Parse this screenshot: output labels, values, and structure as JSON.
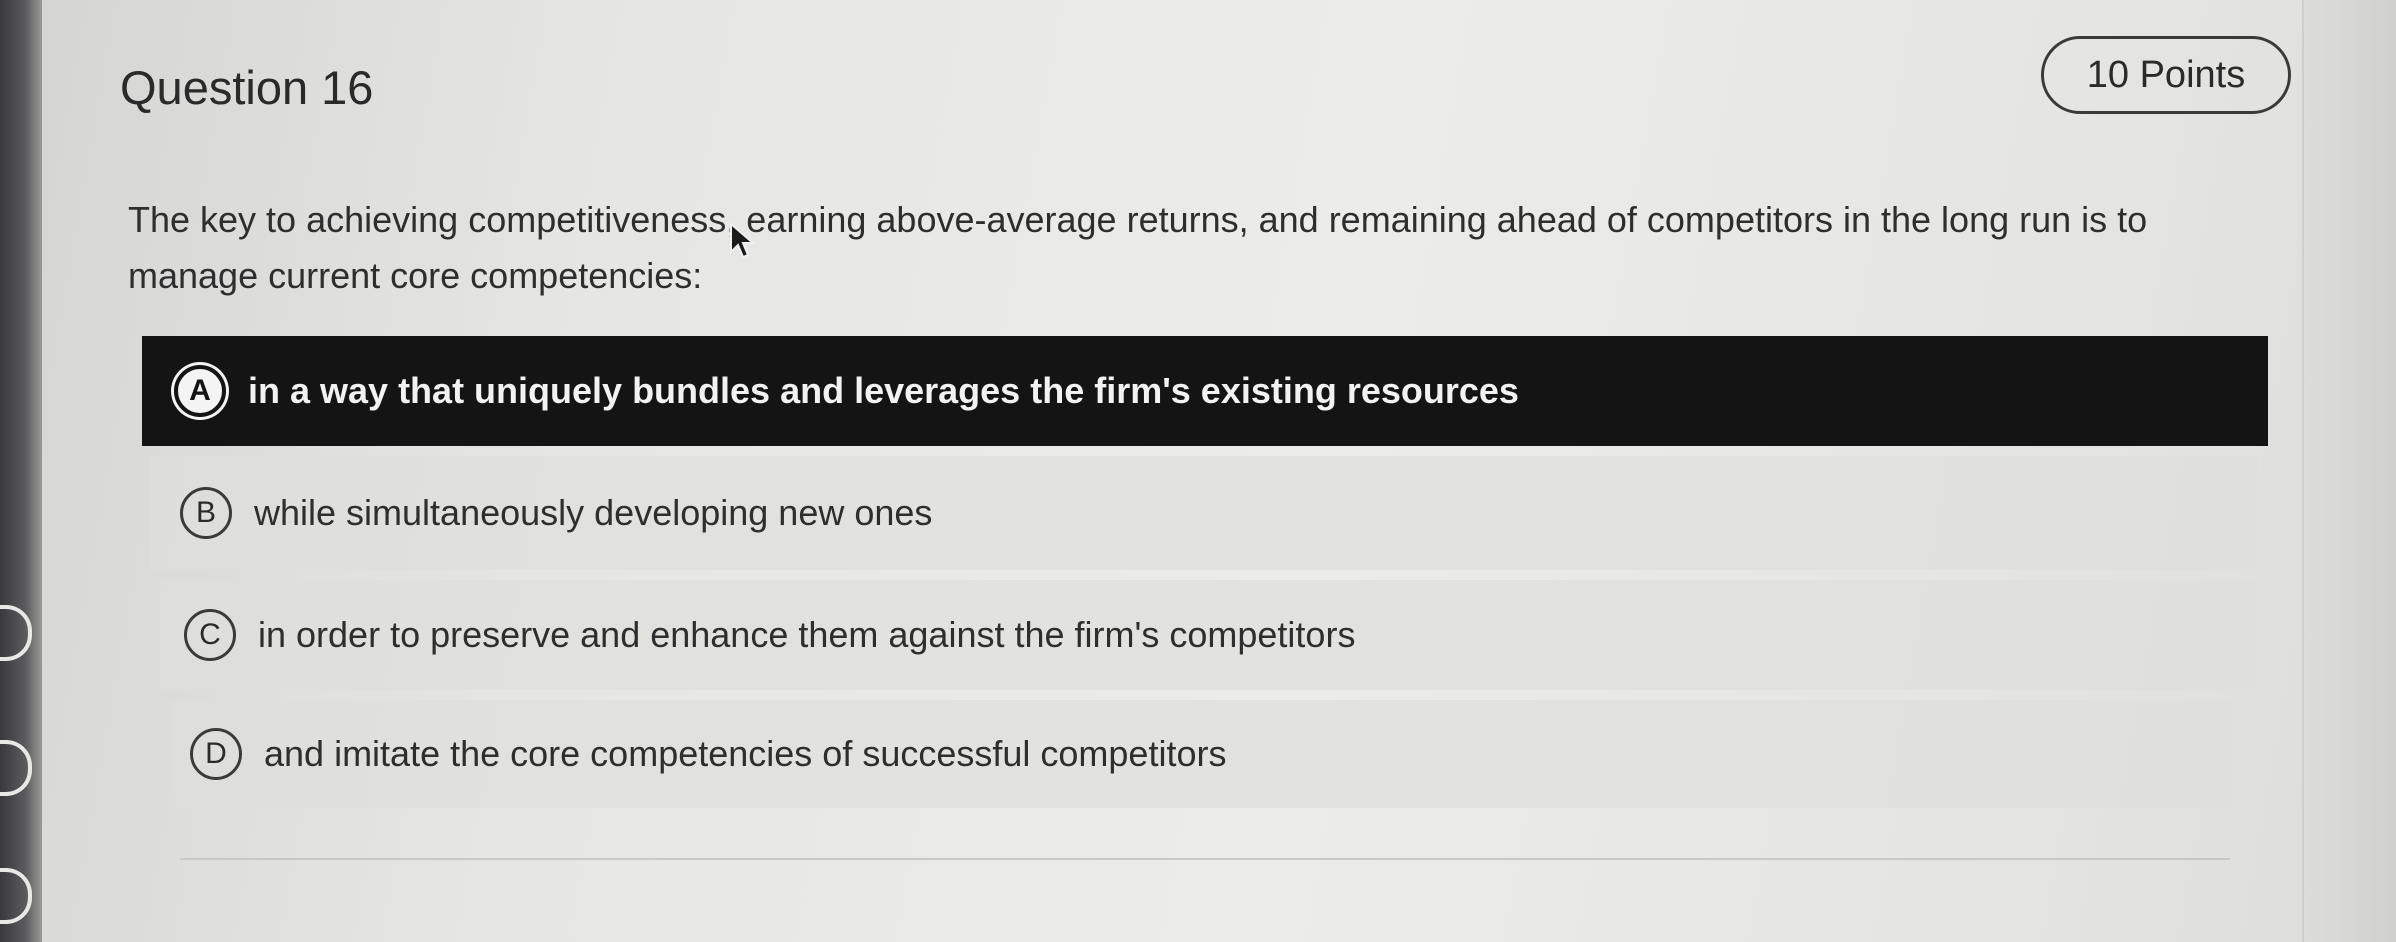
{
  "question": {
    "title": "Question 16",
    "points": "10 Points",
    "prompt": "The key to achieving competitiveness, earning above-average returns, and remaining ahead of competitors in the long run is to manage current core competencies:"
  },
  "options": [
    {
      "letter": "A",
      "text": "in a way that uniquely bundles and leverages the firm's existing resources",
      "selected": true
    },
    {
      "letter": "B",
      "text": "while simultaneously developing new ones",
      "selected": false
    },
    {
      "letter": "C",
      "text": "in order to preserve and enhance them against the firm's competitors",
      "selected": false
    },
    {
      "letter": "D",
      "text": "and imitate the core competencies of successful competitors",
      "selected": false
    }
  ],
  "colors": {
    "selected_background": "#141414",
    "selected_text": "#f2f2f2",
    "page_background": "#e8e8e6"
  },
  "icons": {
    "cursor": "mouse-pointer-icon"
  }
}
